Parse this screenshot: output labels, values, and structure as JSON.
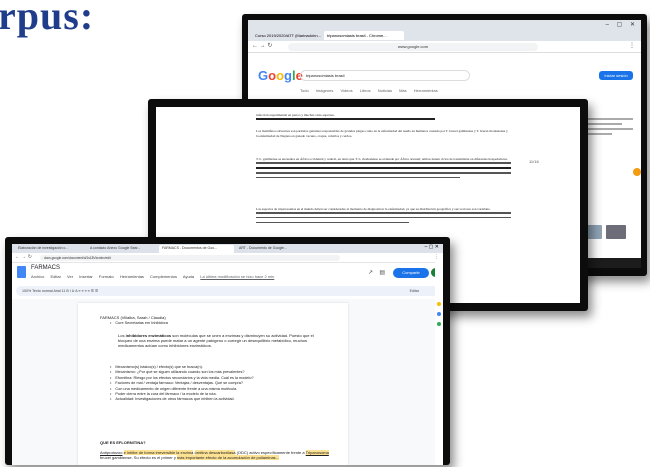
{
  "slide": {
    "title": "rpus:"
  },
  "google_window": {
    "tabs": [
      "Curso 2019/2020/ATT (Marinadohn...",
      "tripanosomiasis brasil - Chrome..."
    ],
    "url": "www.google.com",
    "logo": "Google",
    "query": "tripanosomiasis brasil",
    "nav": "Todo Imágenes Videos Libros Noticias Más Herramientas",
    "stats": "Aproximadamente 1.000.000 resultados (0,48 segundos)",
    "action_button": "Iniciar sesión"
  },
  "document_window": {
    "paragraphs": [
      "infección experimental en perros y muchas otras especies.",
      "Los mamíferos silvestres son parásitos genuinos responsables de grandes plagas como en la enfermedad del sueño en humanos causada por T. brucei gambiense y T. brucei rhodesiense y la enfermedad de Nagana en ganado vacuno, ovejas, caballos y cerdos.",
      "T. b. gambiense se encuentra en África occidental y central, en tanto que T. b. rhodesiense se extiende por África oriental; ambos tienen ciclos de transmisión en diferentes hospedadores.",
      "Las especies de tripanosomas en el mundo deben ser consideradas al momento de diagnosticar la enfermedad, ya que su distribución geográfica y sus vectores son variables."
    ],
    "side_note": "11/16"
  },
  "docs_window": {
    "tabs": [
      "Elaboración de investigación c...",
      "A contacto Anexo Google Sear...",
      "FARMACS - Documentos de Goo...",
      "ART - Documento de Google..."
    ],
    "url": "docs.google.com/document/d/1s18Vkcmbx/edit",
    "doc_name": "FARMACS",
    "menu": [
      "Archivo",
      "Editar",
      "Ver",
      "Insertar",
      "Formato",
      "Herramientas",
      "Complementos",
      "Ayuda"
    ],
    "last_edit": "La última modificación se hizo hace 2 min",
    "share_label": "Compartir",
    "toolbar": "100%  Texto normal  Arial  11  B I U A  ≡ ≡ ≡ ≡  ☰ ☰",
    "edit_mode": "Editar",
    "content": {
      "authors": "FARMACS (Villalba, Sarah / Claudia)",
      "topic_bullet": "Cure Secretarias em Inhibidora",
      "intro_bold": "inhibidores enzimáticos",
      "intro_pre": "Los",
      "intro_post": "son moléculas que se unen a enzimas y disminuyen su actividad. Puesto que el bloqueo de una enzima puede matar a un agente patógeno o corregir un desequilibrio metabólico, muchos medicamentos actúan como inhibidores enzimáticos.",
      "bullets": [
        "Mecanismo(s) básico(s) / efecto(s) que se busca(n).",
        "Mecanismo: ¿Por qué se siguen utilizando cuando son los más prevalentes?",
        "Efornitina: Riesgo por los efectos secundarios y la vida media. Cuál es la modelo?",
        "Factores de mal / ventaja fármaco: Ventajas / desventajas. Qué se compra?",
        "Con una medicamento de origen diferente frente a una misma molécula.",
        "Poder cierra entre la cura del fármaco / la modelo de la ruta.",
        "Actualidad: Investigaciones de otros fármacos que inhiben la actividad."
      ],
      "section_heading": "QUE ES EFLORNITINA?",
      "def_start": "Antiprotozoo",
      "def_mid": "e inhibe de forma irreversible la enzima",
      "def_enzyme": "ornitina descarboxilasa",
      "def_rest": "(ODC) activo específicamente frente a",
      "def_species": "Tripanosoma",
      "def_end": "brucei gambiense. Su efecto es el primer y",
      "def_line2": "más importante efecto de la acumulación de poliaminas..."
    }
  }
}
